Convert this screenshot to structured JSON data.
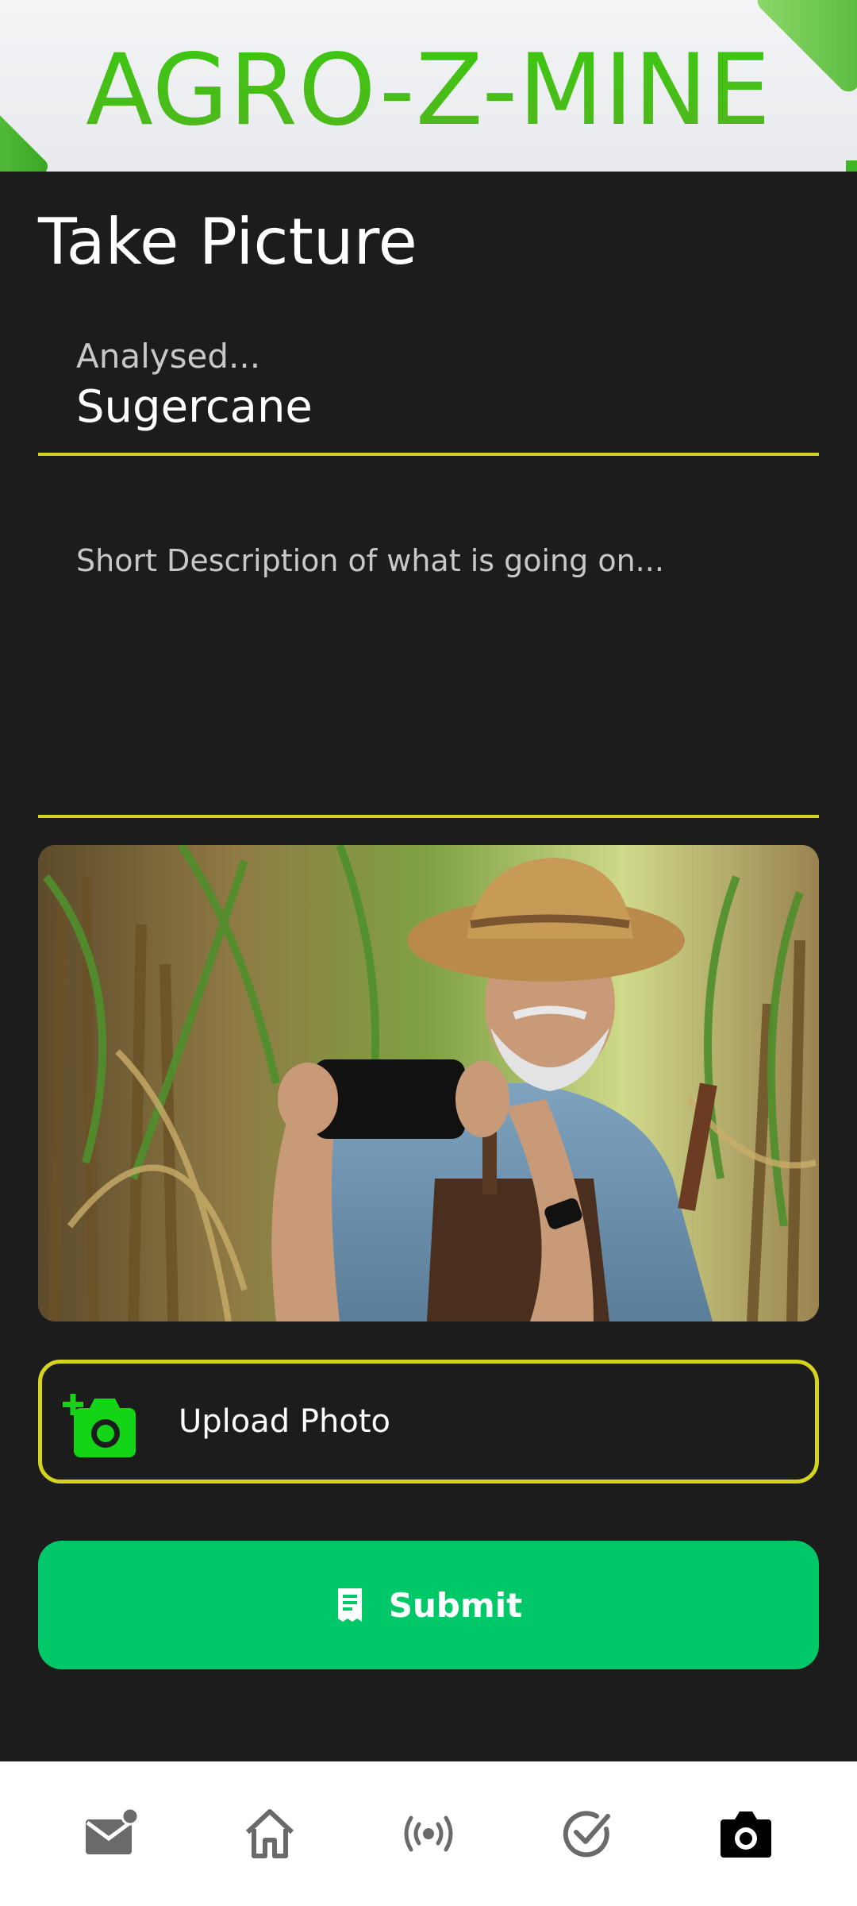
{
  "header": {
    "brand": "AGRO-Z-MINE"
  },
  "page": {
    "title": "Take Picture"
  },
  "form": {
    "analysed_label": "Analysed...",
    "analysed_value": "Sugercane",
    "description_placeholder": "Short Description of what is going on...",
    "upload_label": "Upload Photo",
    "submit_label": "Submit"
  },
  "nav": {
    "items": [
      {
        "icon": "mail-notification-icon",
        "active": false
      },
      {
        "icon": "home-icon",
        "active": false
      },
      {
        "icon": "broadcast-icon",
        "active": false
      },
      {
        "icon": "check-circle-icon",
        "active": false
      },
      {
        "icon": "camera-icon",
        "active": true
      }
    ]
  },
  "colors": {
    "accent_yellow": "#d4d41e",
    "submit_green": "#00c767",
    "brand_green": "#42b91a",
    "background": "#1c1c1c"
  }
}
